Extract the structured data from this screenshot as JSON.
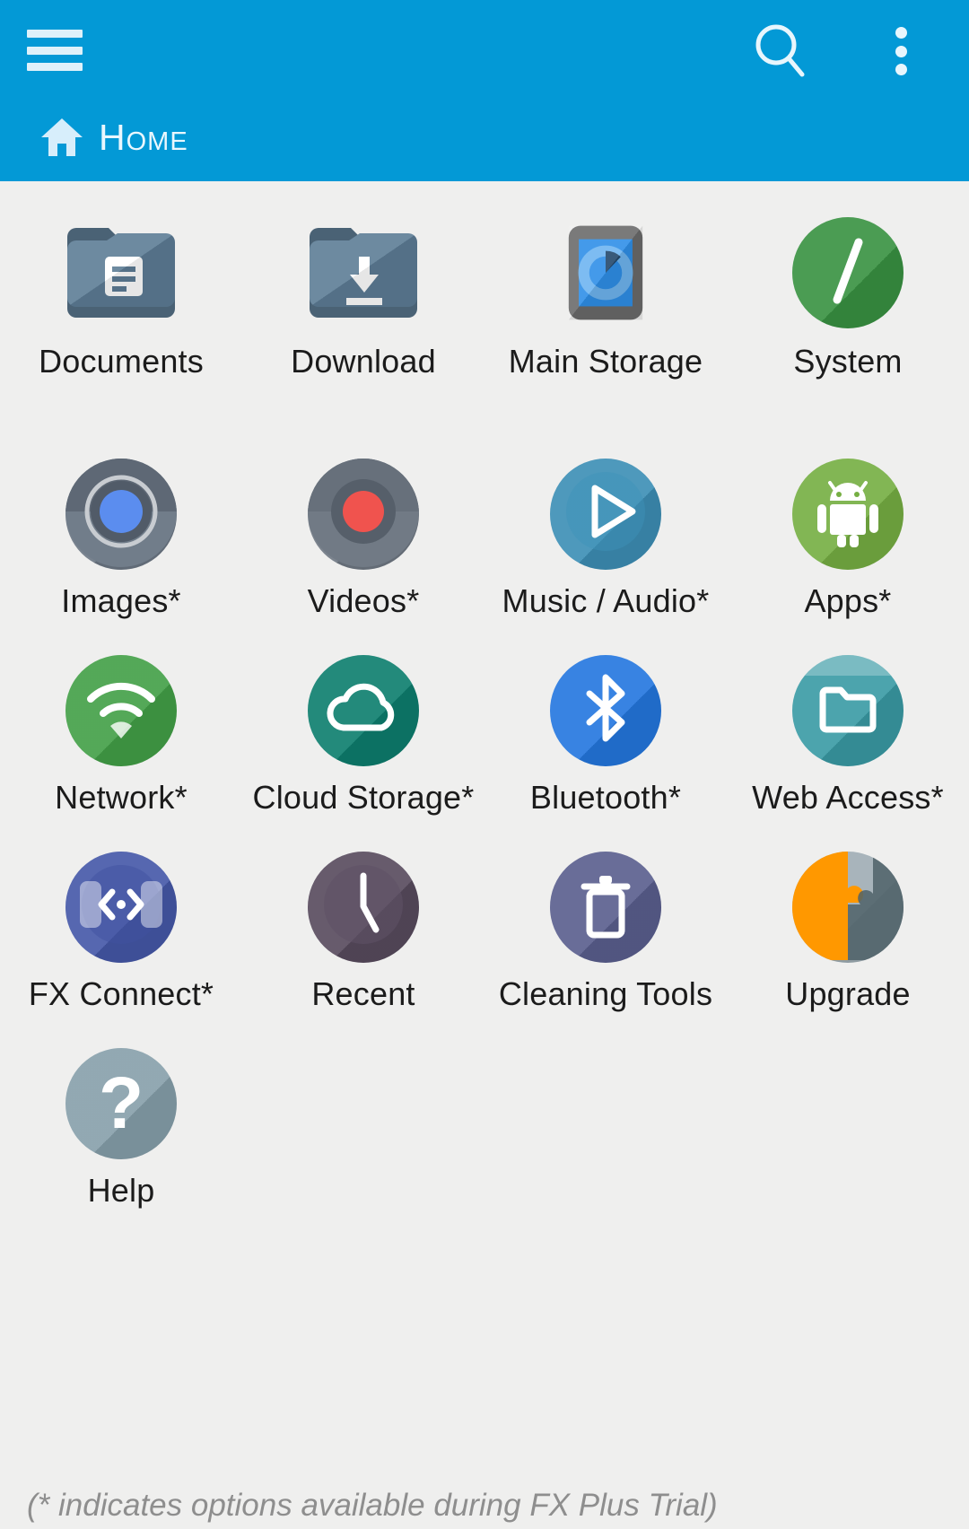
{
  "app": {
    "header_color": "#0399d6",
    "background_color": "#efefee",
    "menu_icon": "hamburger-menu-icon",
    "search_icon": "search-icon",
    "overflow_icon": "overflow-menu-icon"
  },
  "breadcrumb": {
    "home_icon": "home-icon",
    "label": "Home"
  },
  "grid": {
    "rows": [
      [
        {
          "label": "Documents",
          "icon": "folder-documents-icon",
          "color": "#5d7d96"
        },
        {
          "label": "Download",
          "icon": "folder-download-icon",
          "color": "#5d7d96"
        },
        {
          "label": "Main Storage",
          "icon": "device-storage-icon",
          "color": "#6b6b6b"
        },
        {
          "label": "System",
          "icon": "root-slash-icon",
          "color": "#399242"
        }
      ],
      [
        {
          "label": "Images*",
          "icon": "camera-lens-icon",
          "color": "#6c7784"
        },
        {
          "label": "Videos*",
          "icon": "video-disc-icon",
          "color": "#6f7883"
        },
        {
          "label": "Music / Audio*",
          "icon": "play-audio-icon",
          "color": "#3d8fb5"
        },
        {
          "label": "Apps*",
          "icon": "android-robot-icon",
          "color": "#76af43"
        }
      ],
      [
        {
          "label": "Network*",
          "icon": "wifi-icon",
          "color": "#43a047"
        },
        {
          "label": "Cloud Storage*",
          "icon": "cloud-icon",
          "color": "#0d7e6e"
        },
        {
          "label": "Bluetooth*",
          "icon": "bluetooth-icon",
          "color": "#2477df"
        },
        {
          "label": "Web Access*",
          "icon": "web-folder-icon",
          "color": "#3a9ba5"
        }
      ],
      [
        {
          "label": "FX Connect*",
          "icon": "fx-connect-icon",
          "color": "#4558a8"
        },
        {
          "label": "Recent",
          "icon": "clock-icon",
          "color": "#584b5e"
        },
        {
          "label": "Cleaning Tools",
          "icon": "trash-icon",
          "color": "#5a5f8e"
        },
        {
          "label": "Upgrade",
          "icon": "puzzle-icon",
          "color": "#ff9800"
        }
      ],
      [
        {
          "label": "Help",
          "icon": "question-mark-icon",
          "color": "#87a0ab"
        }
      ]
    ]
  },
  "footnote": {
    "text": "(* indicates options available during FX Plus Trial)"
  }
}
